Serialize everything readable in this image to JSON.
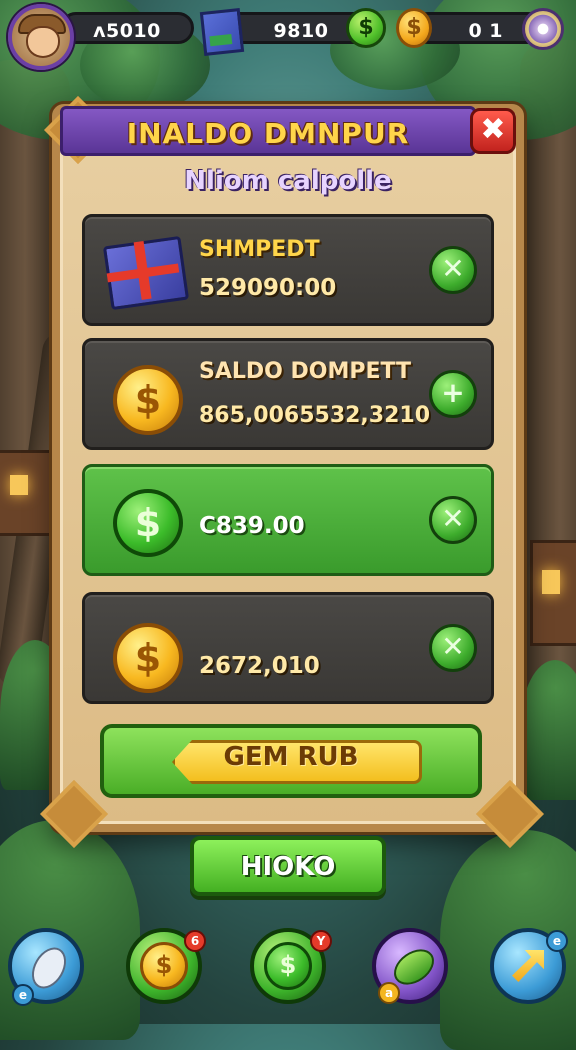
{
  "topbar": {
    "stat1": "ᴧ5010",
    "stat2": "9810",
    "stat3": "0 1",
    "coin_symbol": "$"
  },
  "dialog": {
    "title": "INALDO DMNPUR",
    "subtitle": "Nliom calpolle",
    "close_symbol": "✖"
  },
  "rows": [
    {
      "label": "SHMPEDT",
      "value": "529090:00",
      "button": "✕",
      "icon": "gift-box-icon"
    },
    {
      "label": "SALDO DOMPETT",
      "value": "865,0065532,3210",
      "button": "+",
      "icon": "gold-coin-icon"
    },
    {
      "label": "",
      "value": "C839.00",
      "button": "✕",
      "icon": "green-coin-icon"
    },
    {
      "label": "",
      "value": "2672,010",
      "button": "✕",
      "icon": "gold-coin-icon"
    }
  ],
  "buttons": {
    "primary_label": "GEM RUB",
    "secondary_label": "HIOKO"
  },
  "nav": [
    {
      "icon": "feather-icon",
      "badge": "e"
    },
    {
      "icon": "coin-icon",
      "badge": "6"
    },
    {
      "icon": "dollar-icon",
      "badge": "Y"
    },
    {
      "icon": "leaf-icon",
      "badge": "a"
    },
    {
      "icon": "arrow-icon",
      "badge": "e"
    }
  ],
  "colors": {
    "accent_purple": "#5a3596",
    "accent_gold": "#ffd54a",
    "accent_green": "#44b022",
    "close_red": "#c2231e"
  }
}
